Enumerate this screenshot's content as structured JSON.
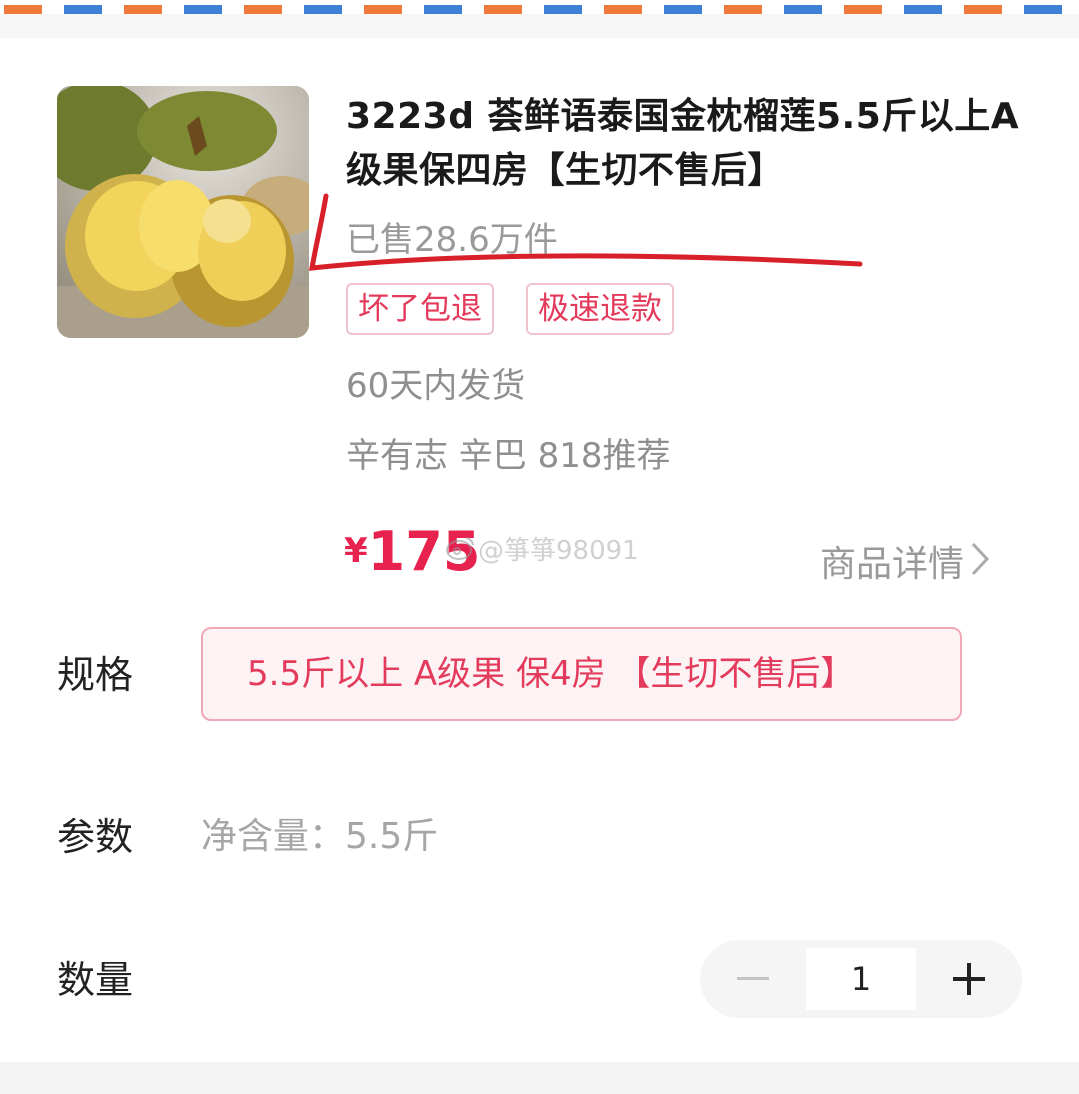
{
  "product": {
    "title": "3223d 荟鲜语泰国金枕榴莲5.5斤以上A级果保四房【生切不售后】",
    "sold": "已售28.6万件",
    "tags": [
      "坏了包退",
      "极速退款"
    ],
    "shipping": "60天内发货",
    "recommend": "辛有志 辛巴 818推荐",
    "price_currency": "¥",
    "price_value": "175",
    "detail_link": "商品详情",
    "watermark": "@箏箏98091",
    "image_icon": "durian-photo"
  },
  "spec": {
    "label": "规格",
    "option": "5.5斤以上 A级果 保4房 【生切不售后】"
  },
  "params": {
    "label": "参数",
    "value": "净含量：5.5斤"
  },
  "quantity": {
    "label": "数量",
    "value": "1"
  },
  "colors": {
    "accent": "#e8224f",
    "tag_border": "#f1c3cc",
    "annotation": "#d8202a"
  }
}
